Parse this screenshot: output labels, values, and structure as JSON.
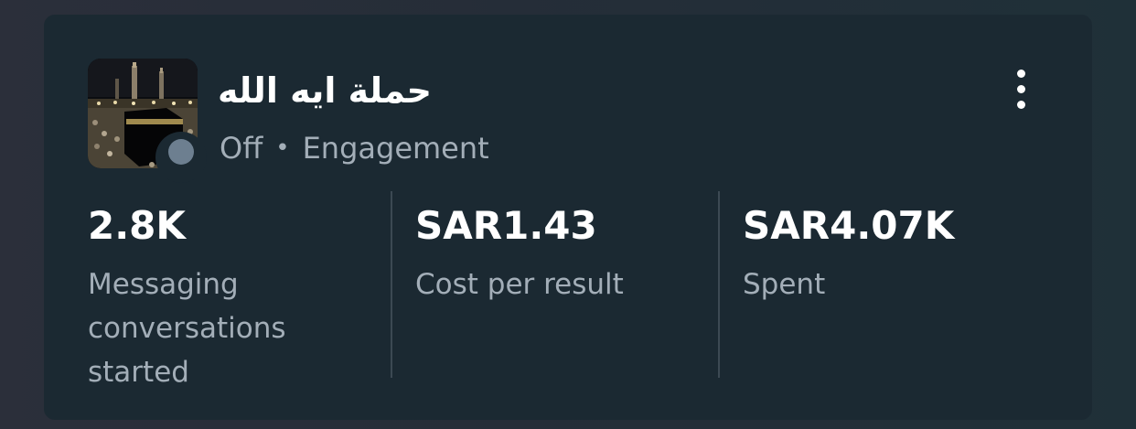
{
  "campaign": {
    "name": "حملة ايه الله",
    "status": "Off",
    "separator": "•",
    "objective": "Engagement"
  },
  "metrics": [
    {
      "value": "2.8K",
      "label": "Messaging conversations started"
    },
    {
      "value": "SAR1.43",
      "label": "Cost per result"
    },
    {
      "value": "SAR4.07K",
      "label": "Spent"
    }
  ],
  "icons": {
    "thumbnail": "kaaba-photo-thumbnail",
    "status": "status-dot-icon",
    "menu": "more-vertical-icon"
  },
  "colors": {
    "card_background": "#1b2932",
    "status_dot": "#6d7f90",
    "secondary_text": "#a3aeb8"
  }
}
